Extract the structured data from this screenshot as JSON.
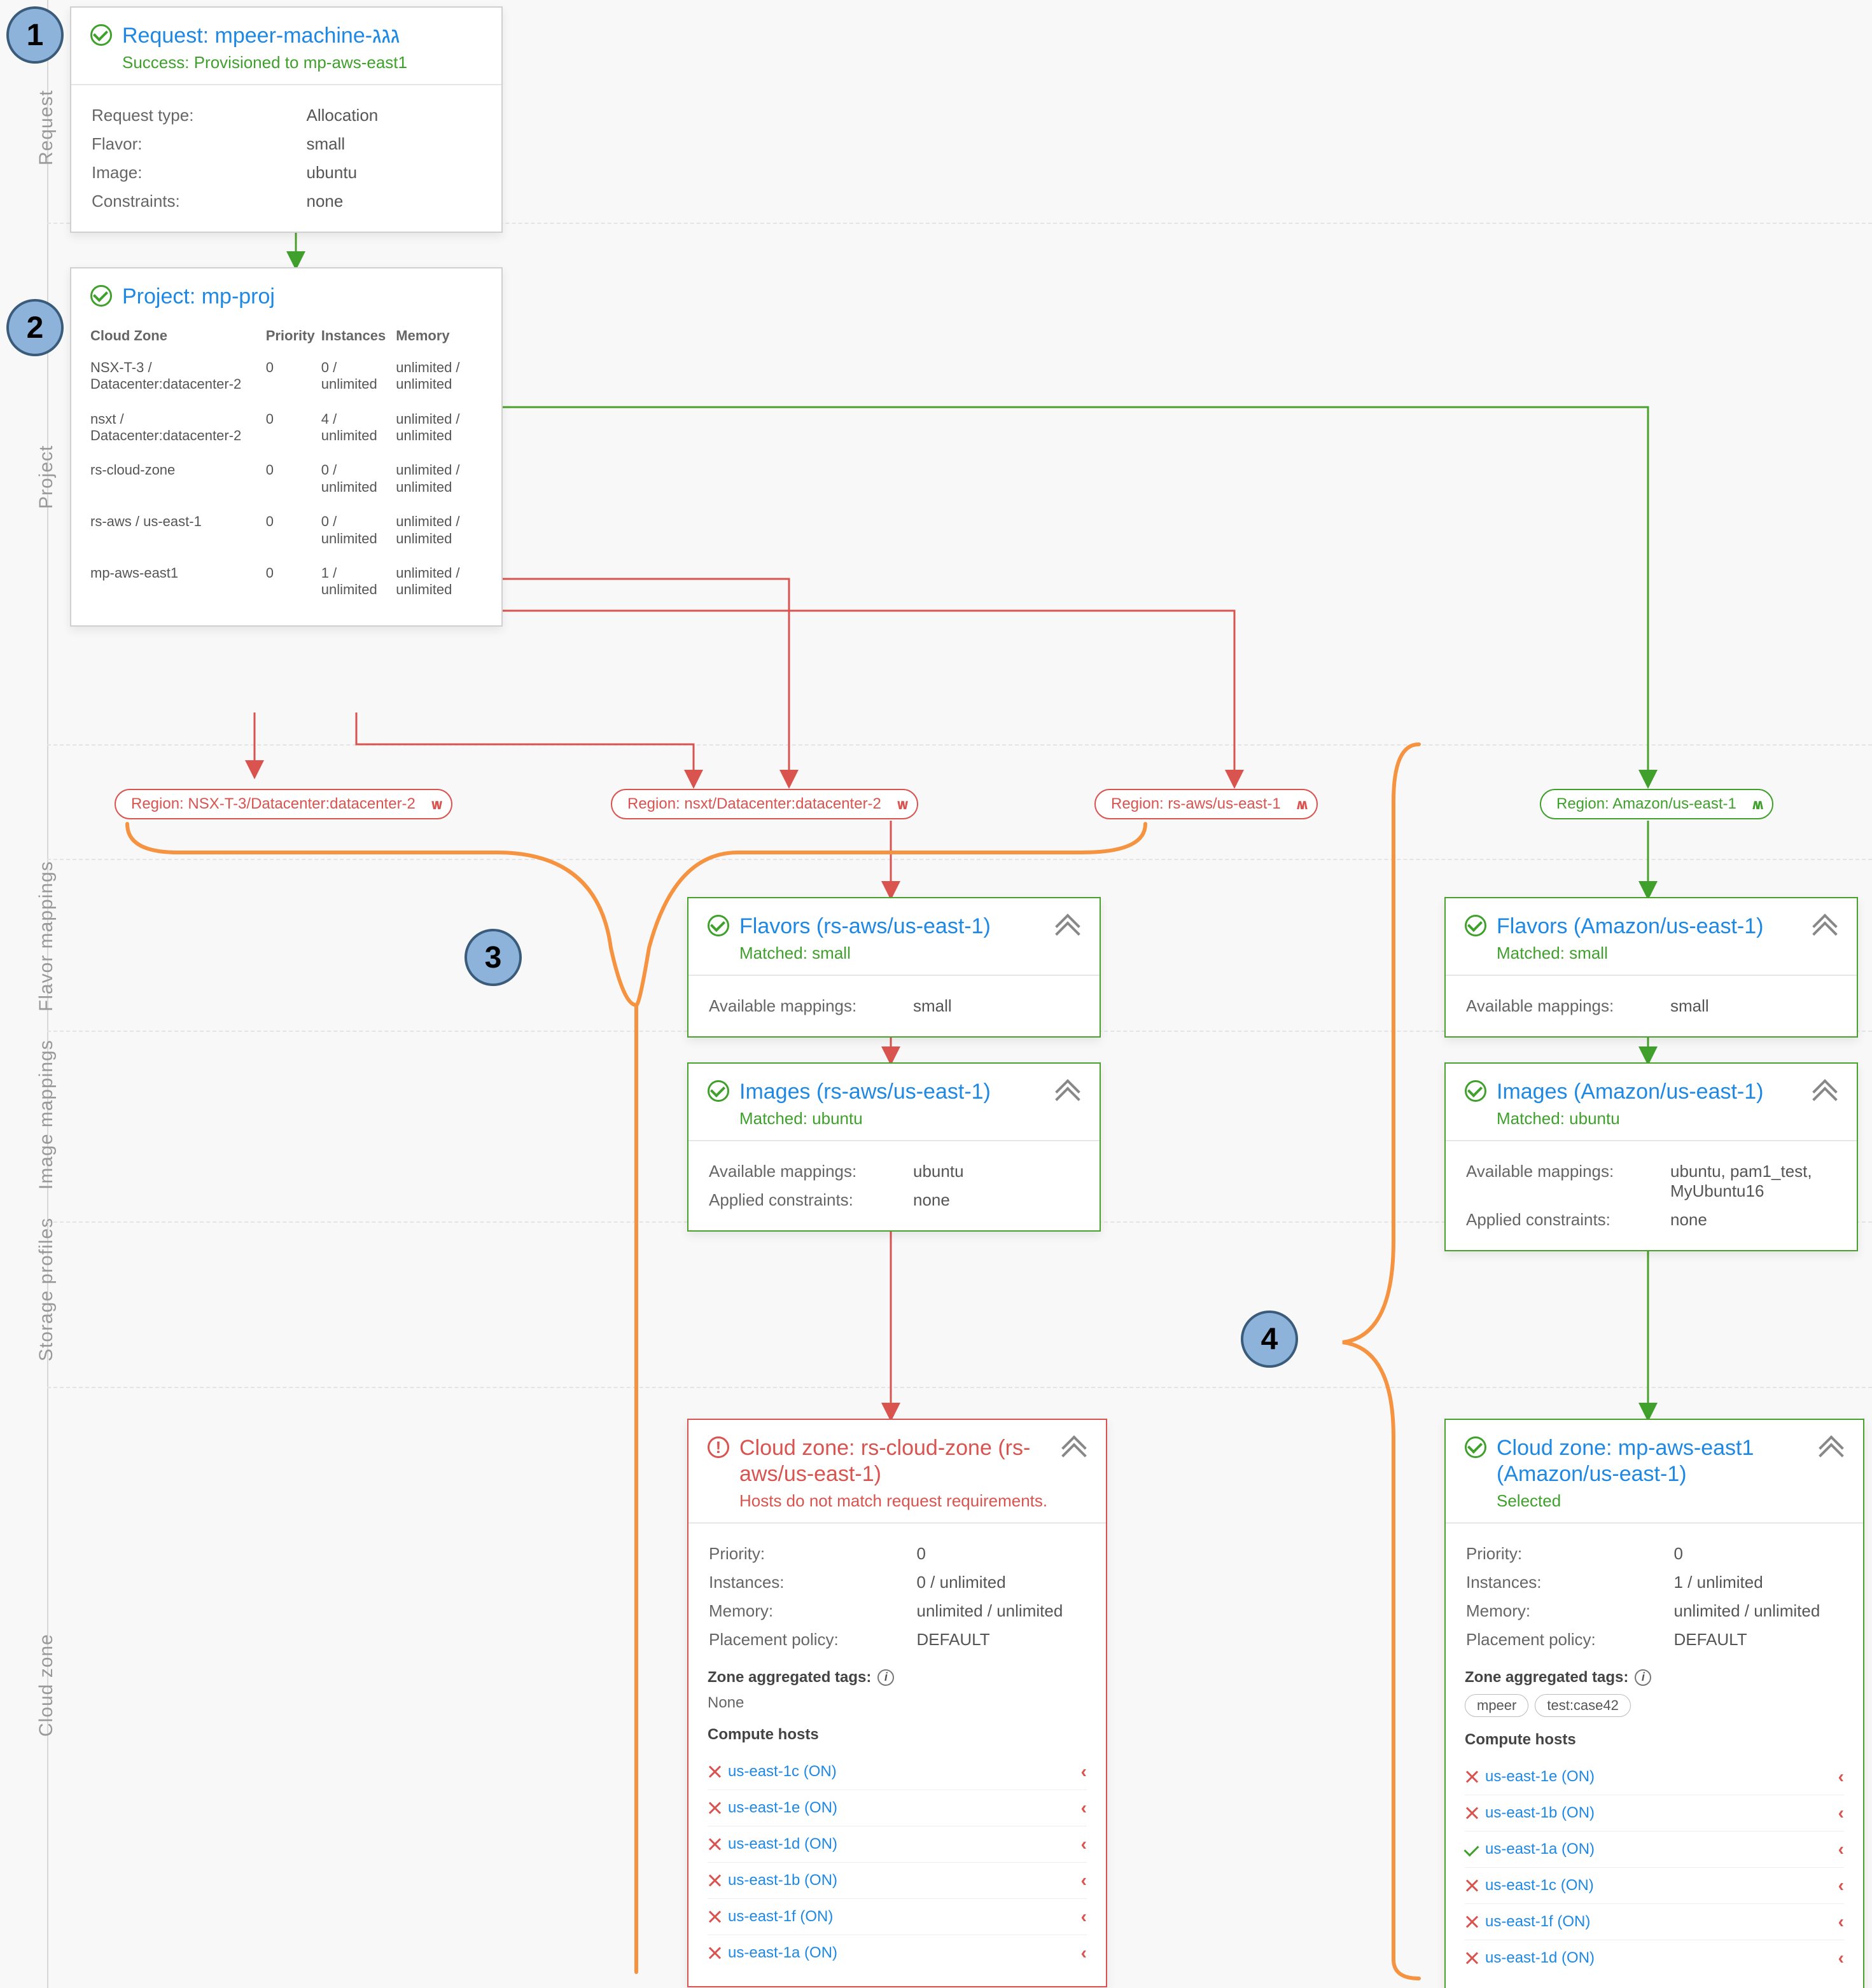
{
  "sections": {
    "request": "Request",
    "project": "Project",
    "flavor": "Flavor mappings",
    "image": "Image mappings",
    "storage": "Storage profiles",
    "cloudzone": "Cloud zone"
  },
  "callouts": [
    "1",
    "2",
    "3",
    "4"
  ],
  "request_card": {
    "title": "Request: mpeer-machine-גגג",
    "success": "Success: Provisioned to mp-aws-east1",
    "rows": [
      {
        "k": "Request type:",
        "v": "Allocation"
      },
      {
        "k": "Flavor:",
        "v": "small"
      },
      {
        "k": "Image:",
        "v": "ubuntu"
      },
      {
        "k": "Constraints:",
        "v": "none"
      }
    ]
  },
  "project_card": {
    "title": "Project: mp-proj",
    "headers": [
      "Cloud Zone",
      "Priority",
      "Instances",
      "Memory"
    ],
    "rows": [
      {
        "cz": "NSX-T-3 / Datacenter:datacenter-2",
        "p": "0",
        "i": "0 / unlimited",
        "m": "unlimited / unlimited"
      },
      {
        "cz": "nsxt / Datacenter:datacenter-2",
        "p": "0",
        "i": "4 / unlimited",
        "m": "unlimited / unlimited"
      },
      {
        "cz": "rs-cloud-zone",
        "p": "0",
        "i": "0 / unlimited",
        "m": "unlimited / unlimited"
      },
      {
        "cz": "rs-aws / us-east-1",
        "p": "0",
        "i": "0 / unlimited",
        "m": "unlimited / unlimited"
      },
      {
        "cz": "mp-aws-east1",
        "p": "0",
        "i": "1 / unlimited",
        "m": "unlimited / unlimited"
      }
    ]
  },
  "regions": [
    {
      "label": "Region: NSX-T-3/Datacenter:datacenter-2",
      "ok": false,
      "dir": "dn"
    },
    {
      "label": "Region: nsxt/Datacenter:datacenter-2",
      "ok": false,
      "dir": "dn"
    },
    {
      "label": "Region: rs-aws/us-east-1",
      "ok": false,
      "dir": "up"
    },
    {
      "label": "Region: Amazon/us-east-1",
      "ok": true,
      "dir": "up"
    }
  ],
  "flavor_left": {
    "title": "Flavors (rs-aws/us-east-1)",
    "matched": "Matched: small",
    "avail_k": "Available mappings:",
    "avail_v": "small"
  },
  "flavor_right": {
    "title": "Flavors (Amazon/us-east-1)",
    "matched": "Matched: small",
    "avail_k": "Available mappings:",
    "avail_v": "small"
  },
  "image_left": {
    "title": "Images (rs-aws/us-east-1)",
    "matched": "Matched: ubuntu",
    "avail_k": "Available mappings:",
    "avail_v": "ubuntu",
    "cons_k": "Applied constraints:",
    "cons_v": "none"
  },
  "image_right": {
    "title": "Images (Amazon/us-east-1)",
    "matched": "Matched: ubuntu",
    "avail_k": "Available mappings:",
    "avail_v": "ubuntu, pam1_test, MyUbuntu16",
    "cons_k": "Applied constraints:",
    "cons_v": "none"
  },
  "cz_left": {
    "title": "Cloud zone: rs-cloud-zone (rs-aws/us-east-1)",
    "sub": "Hosts do not match request requirements.",
    "rows": [
      {
        "k": "Priority:",
        "v": "0"
      },
      {
        "k": "Instances:",
        "v": "0 / unlimited"
      },
      {
        "k": "Memory:",
        "v": "unlimited / unlimited"
      },
      {
        "k": "Placement policy:",
        "v": "DEFAULT"
      }
    ],
    "tags_label": "Zone aggregated tags:",
    "tags_none": "None",
    "hosts_label": "Compute hosts",
    "hosts": [
      {
        "ok": false,
        "name": "us-east-1c (ON)",
        "exp": true
      },
      {
        "ok": false,
        "name": "us-east-1e (ON)",
        "exp": true
      },
      {
        "ok": false,
        "name": "us-east-1d (ON)",
        "exp": true
      },
      {
        "ok": false,
        "name": "us-east-1b (ON)",
        "exp": true
      },
      {
        "ok": false,
        "name": "us-east-1f (ON)",
        "exp": true
      },
      {
        "ok": false,
        "name": "us-east-1a (ON)",
        "exp": true
      }
    ]
  },
  "cz_right": {
    "title": "Cloud zone: mp-aws-east1 (Amazon/us-east-1)",
    "sub": "Selected",
    "rows": [
      {
        "k": "Priority:",
        "v": "0"
      },
      {
        "k": "Instances:",
        "v": "1 / unlimited"
      },
      {
        "k": "Memory:",
        "v": "unlimited / unlimited"
      },
      {
        "k": "Placement policy:",
        "v": "DEFAULT"
      }
    ],
    "tags_label": "Zone aggregated tags:",
    "tags": [
      "mpeer",
      "test:case42"
    ],
    "hosts_label": "Compute hosts",
    "hosts": [
      {
        "ok": false,
        "name": "us-east-1e (ON)",
        "exp": true
      },
      {
        "ok": false,
        "name": "us-east-1b (ON)",
        "exp": true
      },
      {
        "ok": true,
        "name": "us-east-1a (ON)",
        "exp": true
      },
      {
        "ok": false,
        "name": "us-east-1c (ON)",
        "exp": true
      },
      {
        "ok": false,
        "name": "us-east-1f (ON)",
        "exp": true
      },
      {
        "ok": false,
        "name": "us-east-1d (ON)",
        "exp": true
      }
    ]
  }
}
